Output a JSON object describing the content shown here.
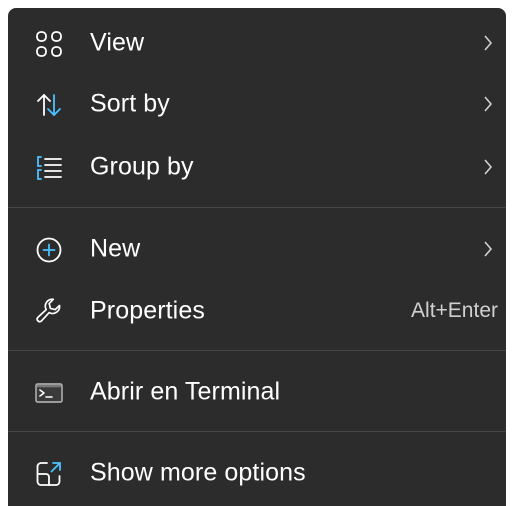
{
  "context_menu": {
    "items": [
      {
        "label": "View",
        "icon": "view-grid-icon",
        "has_submenu": true
      },
      {
        "label": "Sort by",
        "icon": "sort-arrows-icon",
        "has_submenu": true
      },
      {
        "label": "Group by",
        "icon": "group-list-icon",
        "has_submenu": true
      },
      {
        "label": "New",
        "icon": "plus-circle-icon",
        "has_submenu": true
      },
      {
        "label": "Properties",
        "icon": "wrench-icon",
        "shortcut": "Alt+Enter"
      },
      {
        "label": "Abrir en Terminal",
        "icon": "terminal-icon"
      },
      {
        "label": "Show more options",
        "icon": "open-external-icon"
      }
    ]
  },
  "colors": {
    "menu_background": "#2c2c2c",
    "text": "#ffffff",
    "accent": "#4cc2ff",
    "separator": "#474747"
  }
}
